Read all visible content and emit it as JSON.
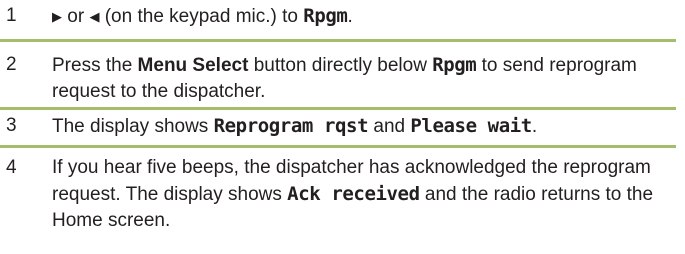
{
  "steps": [
    {
      "number": "1",
      "right_arrow": "▶",
      "text_a": " or ",
      "left_arrow": "◀",
      "text_b": " (on the keypad mic.) to ",
      "display": "Rpgm",
      "text_c": "."
    },
    {
      "number": "2",
      "text_a": "Press the ",
      "bold": "Menu Select",
      "text_b": " button directly below ",
      "display": "Rpgm",
      "text_c": " to send reprogram request to the dispatcher."
    },
    {
      "number": "3",
      "text_a": "The display shows ",
      "display_a": "Reprogram rqst",
      "text_b": " and ",
      "display_b": "Please wait",
      "text_c": "."
    },
    {
      "number": "4",
      "text_a": "If you hear five beeps, the dispatcher has acknowledged the reprogram request. The display shows ",
      "display": "Ack received",
      "text_b": " and the radio returns to the Home screen."
    }
  ],
  "colors": {
    "rule": "#a3bd6a",
    "text": "#231f20"
  }
}
